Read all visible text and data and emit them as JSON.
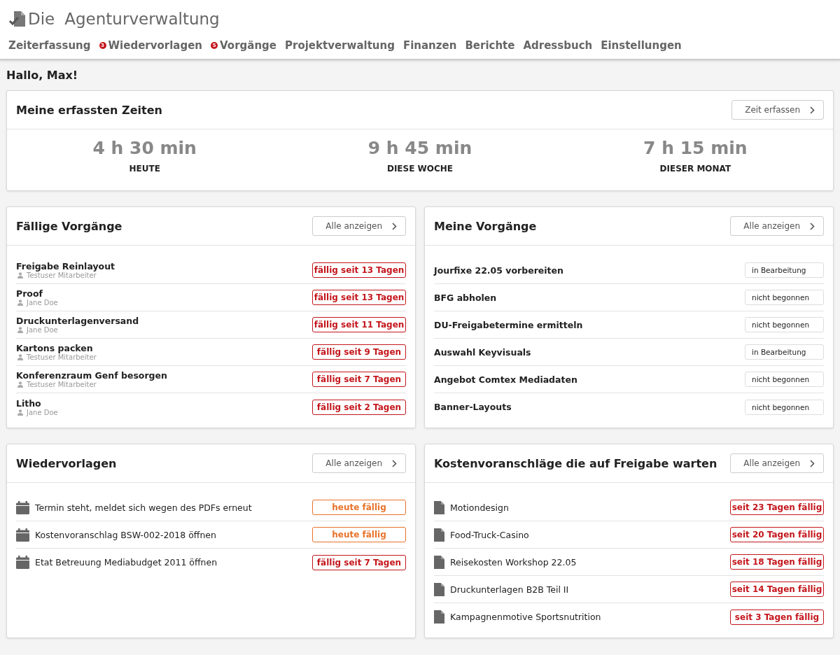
{
  "app": {
    "title_part_1": "Die",
    "title_part_2": "Agenturverwaltung"
  },
  "nav": [
    {
      "label": "Zeiterfassung"
    },
    {
      "label": "Wiedervorlagen",
      "badge": "3"
    },
    {
      "label": "Vorgänge",
      "badge": "5"
    },
    {
      "label": "Projektverwaltung"
    },
    {
      "label": "Finanzen"
    },
    {
      "label": "Berichte"
    },
    {
      "label": "Adressbuch"
    },
    {
      "label": "Einstellungen"
    }
  ],
  "greeting": "Hallo, Max!",
  "times": {
    "title": "Meine erfassten Zeiten",
    "button": "Zeit erfassen",
    "stats": [
      {
        "value": "4 h 30 min",
        "label": "HEUTE"
      },
      {
        "value": "9 h 45 min",
        "label": "DIESE WOCHE"
      },
      {
        "value": "7 h 15 min",
        "label": "DIESER MONAT"
      }
    ]
  },
  "due_tasks": {
    "title": "Fällige Vorgänge",
    "button": "Alle anzeigen",
    "rows": [
      {
        "name": "Freigabe Reinlayout",
        "person": "Testuser Mitarbeiter",
        "status": "fällig seit 13 Tagen",
        "kind": "overdue"
      },
      {
        "name": "Proof",
        "person": "Jane Doe",
        "status": "fällig seit 13 Tagen",
        "kind": "overdue"
      },
      {
        "name": "Druckunterlagenversand",
        "person": "Jane Doe",
        "status": "fällig seit 11 Tagen",
        "kind": "overdue"
      },
      {
        "name": "Kartons packen",
        "person": "Testuser Mitarbeiter",
        "status": "fällig seit 9 Tagen",
        "kind": "overdue"
      },
      {
        "name": "Konferenzraum Genf besorgen",
        "person": "Testuser Mitarbeiter",
        "status": "fällig seit 7 Tagen",
        "kind": "overdue"
      },
      {
        "name": "Litho",
        "person": "Jane Doe",
        "status": "fällig seit 2 Tagen",
        "kind": "overdue"
      }
    ]
  },
  "my_tasks": {
    "title": "Meine Vorgänge",
    "button": "Alle anzeigen",
    "rows": [
      {
        "name": "Jourfixe 22.05 vorbereiten",
        "status": "in Bearbeitung"
      },
      {
        "name": "BFG abholen",
        "status": "nicht begonnen"
      },
      {
        "name": "DU-Freigabetermine ermitteln",
        "status": "nicht begonnen"
      },
      {
        "name": "Auswahl Keyvisuals",
        "status": "in Bearbeitung"
      },
      {
        "name": "Angebot Comtex Mediadaten",
        "status": "nicht begonnen"
      },
      {
        "name": "Banner-Layouts",
        "status": "nicht begonnen"
      }
    ]
  },
  "reminders": {
    "title": "Wiedervorlagen",
    "button": "Alle anzeigen",
    "rows": [
      {
        "name": "Termin steht, meldet sich wegen des PDFs erneut",
        "status": "heute fällig",
        "kind": "today"
      },
      {
        "name": "Kostenvoranschlag BSW-002-2018 öffnen",
        "status": "heute fällig",
        "kind": "today"
      },
      {
        "name": "Etat Betreuung Mediabudget 2011 öffnen",
        "status": "fällig seit 7 Tagen",
        "kind": "overdue"
      }
    ]
  },
  "estimates": {
    "title": "Kostenvoranschläge die auf Freigabe warten",
    "button": "Alle anzeigen",
    "rows": [
      {
        "name": "Motiondesign",
        "status": "seit 23 Tagen fällig",
        "kind": "overdue"
      },
      {
        "name": "Food-Truck-Casino",
        "status": "seit 20 Tagen fällig",
        "kind": "overdue"
      },
      {
        "name": "Reisekosten Workshop 22.05",
        "status": "seit 18 Tagen fällig",
        "kind": "overdue"
      },
      {
        "name": "Druckunterlagen B2B Teil II",
        "status": "seit 14 Tagen fällig",
        "kind": "overdue"
      },
      {
        "name": "Kampagnenmotive Sportsnutrition",
        "status": "seit 3 Tagen fällig",
        "kind": "overdue"
      }
    ]
  }
}
